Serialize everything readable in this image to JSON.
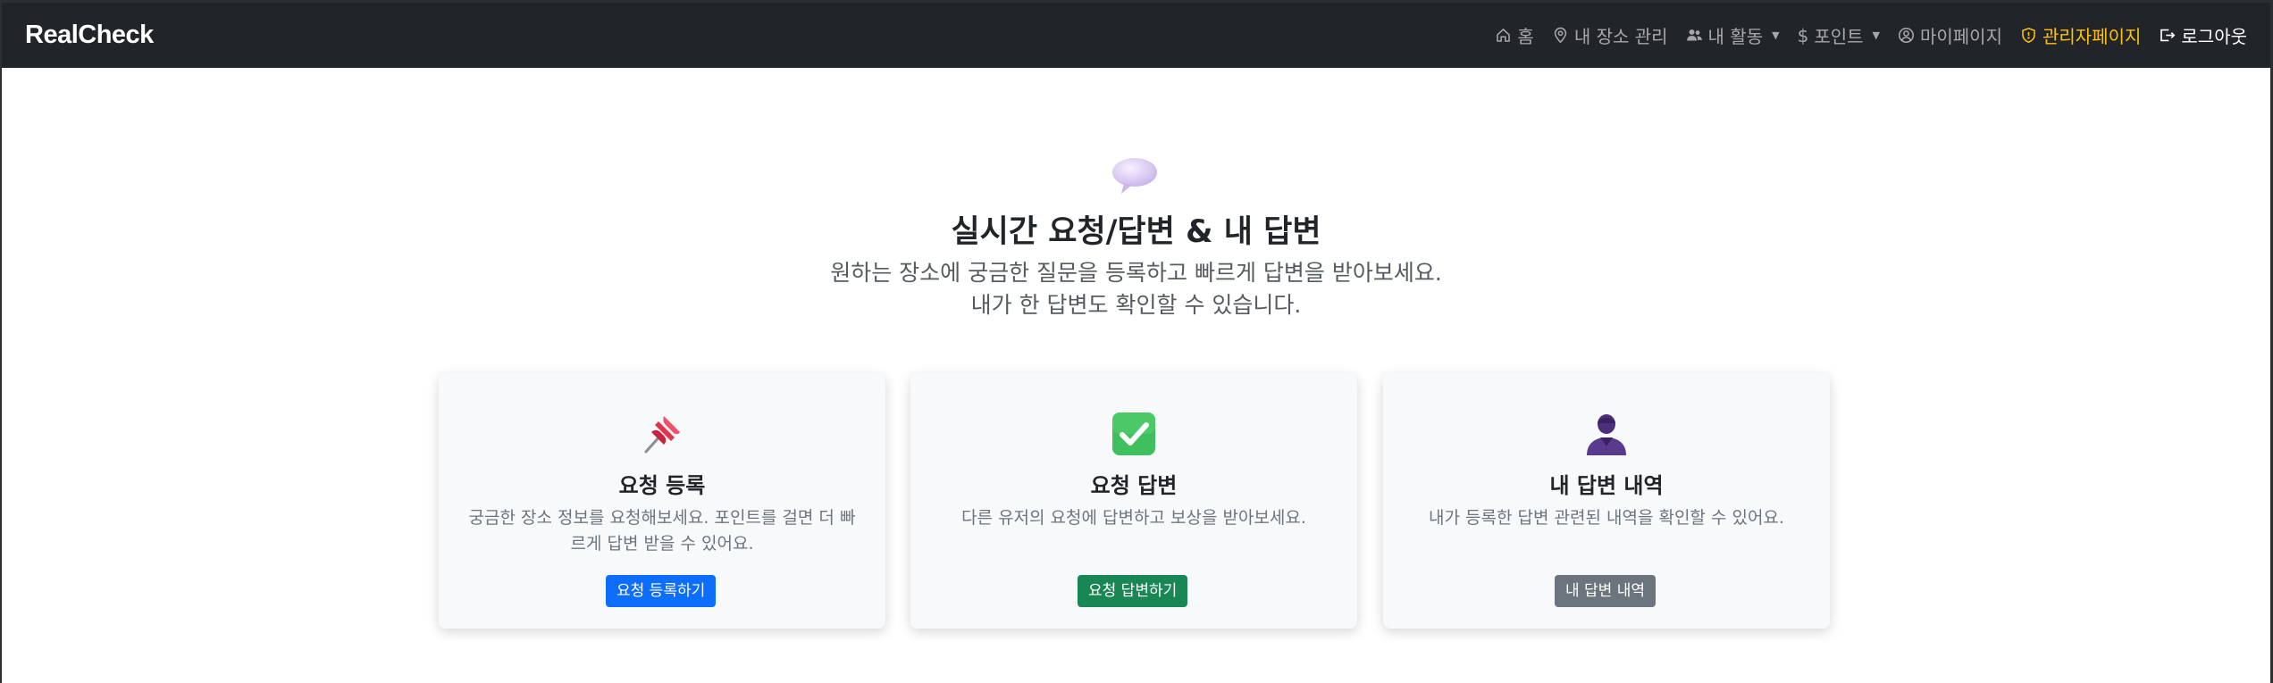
{
  "navbar": {
    "brand": "RealCheck",
    "items": [
      {
        "label": "홈",
        "icon": "home-icon"
      },
      {
        "label": "내 장소 관리",
        "icon": "map-pin-icon"
      },
      {
        "label": "내 활동",
        "icon": "people-icon",
        "dropdown": true
      },
      {
        "label": "포인트",
        "icon": "dollar-icon",
        "dropdown": true
      },
      {
        "label": "마이페이지",
        "icon": "user-circle-icon"
      },
      {
        "label": "관리자페이지",
        "icon": "shield-icon"
      },
      {
        "label": "로그아웃",
        "icon": "logout-icon"
      }
    ],
    "colors": {
      "bg": "#212529",
      "admin": "#ffc107"
    }
  },
  "hero": {
    "icon": "speech-bubble-icon",
    "title": "실시간 요청/답변 & 내 답변",
    "subtitle_line1": "원하는 장소에 궁금한 질문을 등록하고 빠르게 답변을 받아보세요.",
    "subtitle_line2": "내가 한 답변도 확인할 수 있습니다."
  },
  "cards": [
    {
      "icon": "pushpin-icon",
      "title": "요청 등록",
      "text": "궁금한 장소 정보를 요청해보세요. 포인트를 걸면 더 빠르게 답변 받을 수 있어요.",
      "button": "요청 등록하기",
      "button_color": "#0d6efd"
    },
    {
      "icon": "check-mark-icon",
      "title": "요청 답변",
      "text": "다른 유저의 요청에 답변하고 보상을 받아보세요.",
      "button": "요청 답변하기",
      "button_color": "#198754"
    },
    {
      "icon": "user-silhouette-icon",
      "title": "내 답변 내역",
      "text": "내가 등록한 답변 관련된 내역을 확인할 수 있어요.",
      "button": "내 답변 내역",
      "button_color": "#6c757d"
    }
  ]
}
